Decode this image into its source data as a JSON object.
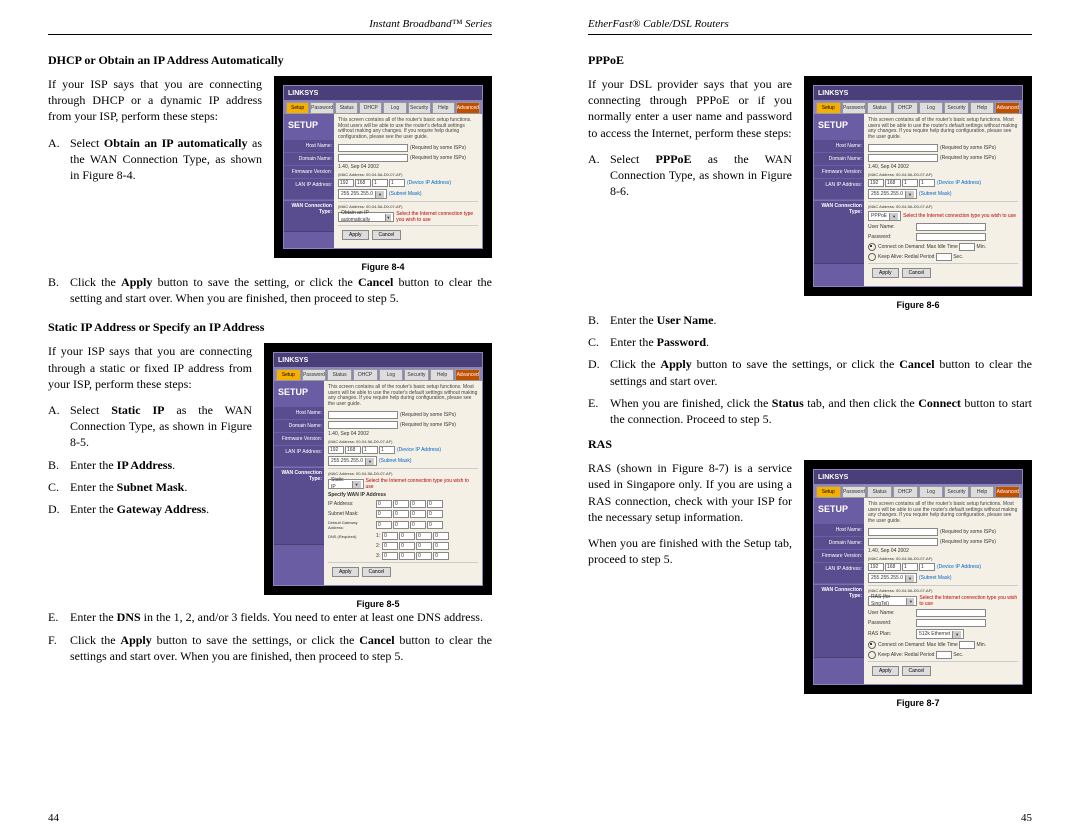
{
  "left_header": "Instant Broadband™ Series",
  "right_header": "EtherFast® Cable/DSL Routers",
  "left_page_num": "44",
  "right_page_num": "45",
  "router_common": {
    "logo": "LINKSYS",
    "tabs": [
      "Setup",
      "Password",
      "Status",
      "DHCP",
      "Log",
      "Security",
      "Help"
    ],
    "tab_advanced": "Advanced",
    "setup_label": "SETUP",
    "desc": "This screen contains all of the router's basic setup functions. Most users will be able to use the router's default settings without making any changes. If you require help during configuration, please see the user guide.",
    "side_labels": {
      "host": "Host Name:",
      "domain": "Domain Name:",
      "firmware": "Firmware Version:",
      "lan": "LAN IP Address:",
      "wan": "WAN Connection Type:"
    },
    "field_hints": {
      "required": "(Required by some ISPs)",
      "firmware_val": "1.40, Sep 04 2002",
      "mac": "(MAC Address: 00-04-5A-D0-07-AF)",
      "device_ip": "(Device IP Address)",
      "subnet_mask_label": "(Subnet Mask)",
      "ip_parts": [
        "192",
        "168",
        "1",
        "1"
      ],
      "subnet_select": "255.255.255.0",
      "wan_note": "Select the Internet connection type you wish to use"
    },
    "buttons": {
      "apply": "Apply",
      "cancel": "Cancel"
    }
  },
  "fig84": {
    "caption": "Figure 8-4",
    "wan_select": "Obtain an IP automatically"
  },
  "fig85": {
    "caption": "Figure 8-5",
    "wan_select": "Static IP",
    "specify_title": "Specify WAN IP Address",
    "rows": {
      "ip": "IP Address:",
      "subnet": "Subnet Mask:",
      "gateway": "Default Gateway Address:",
      "dns": "DNS (Required)"
    },
    "ip_zeros": [
      "0",
      "0",
      "0",
      "0"
    ],
    "dns_labels": [
      "1:",
      "2:",
      "3:"
    ]
  },
  "fig86": {
    "caption": "Figure 8-6",
    "wan_select": "PPPoE",
    "rows": {
      "user": "User Name:",
      "pass": "Password:",
      "cod": "Connect on Demand: Max Idle Time",
      "ka": "Keep Alive: Redial Period",
      "min": "Min.",
      "sec": "Sec."
    }
  },
  "fig87": {
    "caption": "Figure 8-7",
    "wan_select": "RAS (for SingTel)",
    "rows": {
      "user": "User Name:",
      "pass": "Password:",
      "ras_plan": "RAS Plan:",
      "ras_plan_val": "512k Ethernet",
      "cod": "Connect on Demand: Max Idle Time",
      "ka": "Keep Alive: Redial Period",
      "min": "Min.",
      "sec": "Sec."
    }
  },
  "sections": {
    "dhcp_title": "DHCP or Obtain an IP Address Automatically",
    "dhcp_intro": "If your ISP says that you are connecting through DHCP or a dynamic IP address from your ISP, perform these steps:",
    "dhcp_a_pre": "Select ",
    "dhcp_a_bold": "Obtain an IP automatically",
    "dhcp_a_post": " as the WAN Connection Type, as shown in Figure 8-4.",
    "dhcp_b_pre": "Click the ",
    "dhcp_b_bold1": "Apply",
    "dhcp_b_mid": " button to save the setting, or click the ",
    "dhcp_b_bold2": "Cancel",
    "dhcp_b_post": " button to clear the setting and start over. When you are finished, then proceed to step 5.",
    "static_title": "Static IP Address or Specify an IP Address",
    "static_intro": "If your ISP says that you are connecting through a static or fixed IP address from your ISP, perform these steps:",
    "static_a_pre": "Select ",
    "static_a_bold": "Static IP",
    "static_a_post": " as the WAN Connection Type, as shown in Figure 8-5.",
    "static_b_pre": "Enter the ",
    "static_b_bold": "IP Address",
    "static_b_post": ".",
    "static_c_pre": "Enter the ",
    "static_c_bold": "Subnet Mask",
    "static_c_post": ".",
    "static_d_pre": "Enter the ",
    "static_d_bold": "Gateway Address",
    "static_d_post": ".",
    "static_e_pre": "Enter the ",
    "static_e_bold": "DNS",
    "static_e_post": " in the 1, 2, and/or 3 fields. You need to enter at least one DNS address.",
    "static_f_pre": "Click the ",
    "static_f_bold1": "Apply",
    "static_f_mid": " button to save the settings, or click the ",
    "static_f_bold2": "Cancel",
    "static_f_post": " button to clear the settings and start over. When you are finished, then proceed to step 5.",
    "pppoe_title": "PPPoE",
    "pppoe_intro": "If your DSL provider says that you are connecting through PPPoE or if you normally enter a user name and password to access the Internet, perform these steps:",
    "pppoe_a_pre": "Select ",
    "pppoe_a_bold": "PPPoE",
    "pppoe_a_post": " as the WAN Connection Type, as shown in Figure 8-6.",
    "pppoe_b_pre": "Enter the ",
    "pppoe_b_bold": "User Name",
    "pppoe_b_post": ".",
    "pppoe_c_pre": "Enter the ",
    "pppoe_c_bold": "Password",
    "pppoe_c_post": ".",
    "pppoe_d_pre": "Click the ",
    "pppoe_d_bold1": "Apply",
    "pppoe_d_mid": " button to save the settings, or click the ",
    "pppoe_d_bold2": "Cancel",
    "pppoe_d_post": " button to clear the settings and start over.",
    "pppoe_e_pre": "When you are finished, click the ",
    "pppoe_e_bold1": "Status",
    "pppoe_e_mid": " tab, and then click the ",
    "pppoe_e_bold2": "Connect",
    "pppoe_e_post": " button to start the connection. Proceed to step 5.",
    "ras_title": "RAS",
    "ras_intro": "RAS (shown in Figure 8-7) is a service used in Singapore only. If you are using a RAS connection, check with your ISP for the necessary setup information.",
    "ras_after": "When you are finished with the Setup tab, proceed to step 5."
  }
}
